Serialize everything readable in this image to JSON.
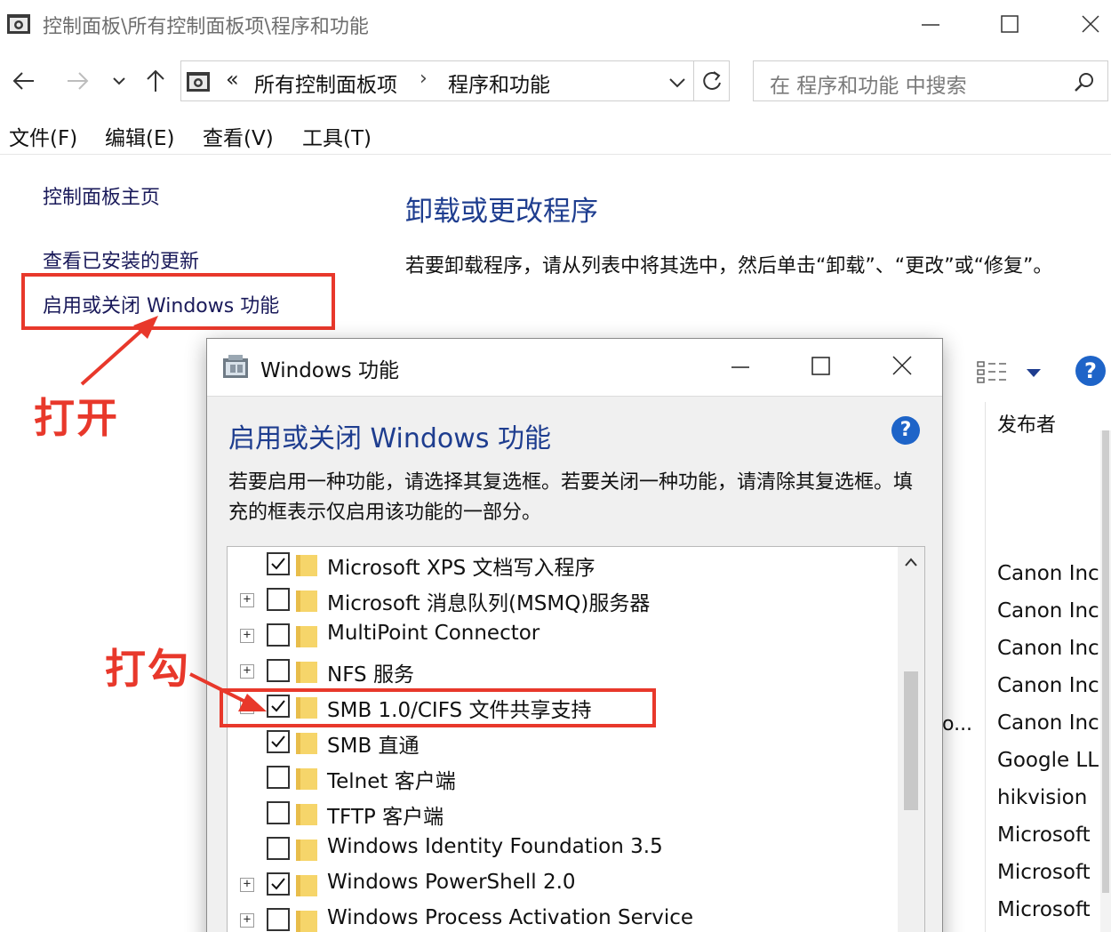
{
  "window": {
    "title": "控制面板\\所有控制面板项\\程序和功能"
  },
  "address": {
    "chevron": "«",
    "segment1": "所有控制面板项",
    "separator": "›",
    "segment2": "程序和功能"
  },
  "search": {
    "placeholder": "在 程序和功能 中搜索"
  },
  "menu": {
    "items": [
      "文件(F)",
      "编辑(E)",
      "查看(V)",
      "工具(T)"
    ]
  },
  "left_pane": {
    "home": "控制面板主页",
    "updates": "查看已安装的更新",
    "windows_features": "启用或关闭 Windows 功能"
  },
  "main": {
    "heading": "卸载或更改程序",
    "description": "若要卸载程序，请从列表中将其选中，然后单击“卸载”、“更改”或“修复”。",
    "publisher_header": "发布者",
    "truncated": "o...",
    "publishers": [
      "Canon Inc",
      "Canon Inc",
      "Canon Inc",
      "Canon Inc",
      "Canon Inc",
      "Google LL",
      "hikvision",
      "Microsoft",
      "Microsoft",
      "Microsoft"
    ],
    "help": "?"
  },
  "annotations": {
    "open": "打开",
    "check": "打勾",
    "color": "#e8382b"
  },
  "dialog": {
    "title": "Windows 功能",
    "heading": "启用或关闭 Windows 功能",
    "help": "?",
    "description": "若要启用一种功能，请选择其复选框。若要关闭一种功能，请清除其复选框。填充的框表示仅启用该功能的一部分。",
    "features": [
      {
        "label": "Microsoft XPS 文档写入程序",
        "checked": true,
        "expandable": false
      },
      {
        "label": "Microsoft 消息队列(MSMQ)服务器",
        "checked": false,
        "expandable": true
      },
      {
        "label": "MultiPoint Connector",
        "checked": false,
        "expandable": true
      },
      {
        "label": "NFS 服务",
        "checked": false,
        "expandable": true
      },
      {
        "label": "SMB 1.0/CIFS 文件共享支持",
        "checked": true,
        "expandable": true
      },
      {
        "label": "SMB 直通",
        "checked": true,
        "expandable": false
      },
      {
        "label": "Telnet 客户端",
        "checked": false,
        "expandable": false
      },
      {
        "label": "TFTP 客户端",
        "checked": false,
        "expandable": false
      },
      {
        "label": "Windows Identity Foundation 3.5",
        "checked": false,
        "expandable": false
      },
      {
        "label": "Windows PowerShell 2.0",
        "checked": true,
        "expandable": true
      },
      {
        "label": "Windows Process Activation Service",
        "checked": false,
        "expandable": true
      }
    ]
  },
  "colors": {
    "link_blue": "#1e3d8f",
    "help_blue": "#1e64c8",
    "folder_yellow": "#f6d56a"
  }
}
